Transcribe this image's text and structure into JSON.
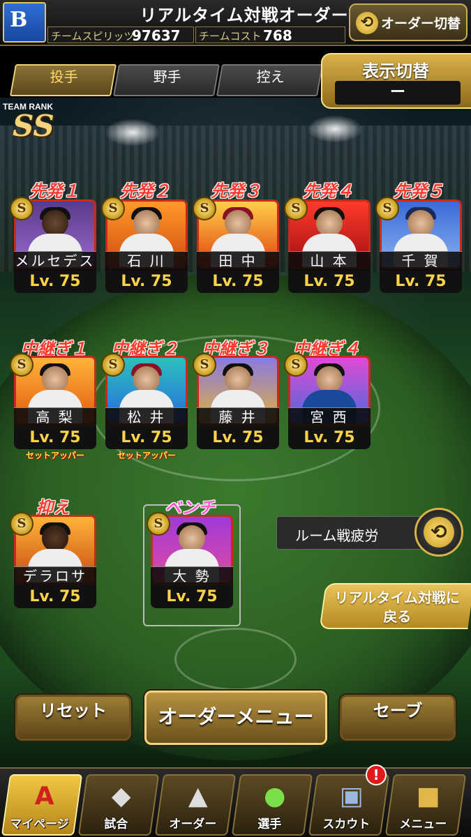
{
  "header": {
    "title": "リアルタイム対戦オーダー",
    "team_spirit_label": "チームスピリッツ",
    "team_spirit_value": "97637",
    "team_cost_label": "チームコスト",
    "team_cost_value": "768",
    "order_switch_label": "オーダー切替"
  },
  "tabs": [
    {
      "label": "投手",
      "active": true
    },
    {
      "label": "野手",
      "active": false
    },
    {
      "label": "控え",
      "active": false
    }
  ],
  "display_switch": {
    "label": "表示切替",
    "value": "ー"
  },
  "team_rank": {
    "label": "TEAM RANK",
    "value": "SS"
  },
  "badge_letter": "S",
  "players": {
    "starters": [
      {
        "slot": "先発１",
        "name": "メルセデス",
        "level": "Lv. 75",
        "role": ""
      },
      {
        "slot": "先発２",
        "name": "石 川",
        "level": "Lv. 75",
        "role": ""
      },
      {
        "slot": "先発３",
        "name": "田 中",
        "level": "Lv. 75",
        "role": ""
      },
      {
        "slot": "先発４",
        "name": "山 本",
        "level": "Lv. 75",
        "role": ""
      },
      {
        "slot": "先発５",
        "name": "千 賀",
        "level": "Lv. 75",
        "role": ""
      }
    ],
    "relievers": [
      {
        "slot": "中継ぎ１",
        "name": "高 梨",
        "level": "Lv. 75",
        "role": "セットアッパー"
      },
      {
        "slot": "中継ぎ２",
        "name": "松 井",
        "level": "Lv. 75",
        "role": "セットアッパー"
      },
      {
        "slot": "中継ぎ３",
        "name": "藤 井",
        "level": "Lv. 75",
        "role": ""
      },
      {
        "slot": "中継ぎ４",
        "name": "宮 西",
        "level": "Lv. 75",
        "role": ""
      }
    ],
    "closer": {
      "slot": "抑え",
      "name": "デラロサ",
      "level": "Lv. 75"
    },
    "bench": {
      "slot": "ベンチ",
      "name": "大 勢",
      "level": "Lv. 75"
    }
  },
  "side": {
    "fatigue_label": "ルーム戦疲労",
    "return_label_line1": "リアルタイム対戦に",
    "return_label_line2": "戻る"
  },
  "actions": {
    "reset": "リセット",
    "order_menu": "オーダーメニュー",
    "save": "セーブ"
  },
  "nav": [
    {
      "label": "マイページ",
      "icon": "A",
      "active": true
    },
    {
      "label": "試合",
      "icon": "◆",
      "active": false
    },
    {
      "label": "オーダー",
      "icon": "▲",
      "active": false
    },
    {
      "label": "選手",
      "icon": "●",
      "active": false
    },
    {
      "label": "スカウト",
      "icon": "▣",
      "active": false
    },
    {
      "label": "メニュー",
      "icon": "■",
      "active": false
    }
  ],
  "nav_badge": "!"
}
